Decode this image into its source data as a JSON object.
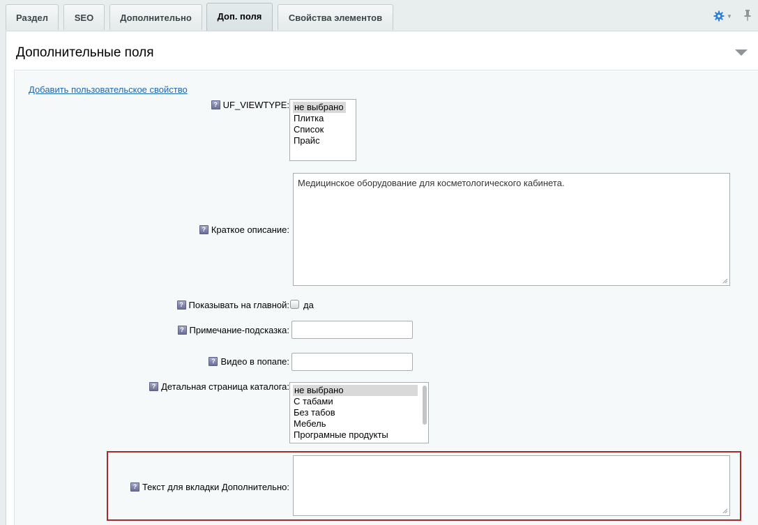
{
  "tabs": [
    {
      "label": "Раздел"
    },
    {
      "label": "SEO"
    },
    {
      "label": "Дополнительно"
    },
    {
      "label": "Доп. поля",
      "active": true
    },
    {
      "label": "Свойства элементов"
    }
  ],
  "panel": {
    "title": "Дополнительные поля",
    "add_link": "Добавить пользовательское свойство"
  },
  "fields": {
    "viewtype": {
      "label": "UF_VIEWTYPE:",
      "options": [
        "не выбрано",
        "Плитка",
        "Список",
        "Прайс"
      ],
      "selected": "не выбрано"
    },
    "short_desc": {
      "label": "Краткое описание:",
      "value": "Медицинское оборудование для косметологического кабинета."
    },
    "show_main": {
      "label": "Показывать на главной:",
      "checkbox_label": "да",
      "checked": false
    },
    "hint": {
      "label": "Примечание-подсказка:",
      "value": ""
    },
    "video": {
      "label": "Видео в попапе:",
      "value": ""
    },
    "catalog_page": {
      "label": "Детальная страница каталога:",
      "options": [
        "не выбрано",
        "С табами",
        "Без табов",
        "Мебель",
        "Програмные продукты"
      ],
      "selected": "не выбрано"
    },
    "tab_text": {
      "label": "Текст для вкладки Дополнительно:",
      "value": ""
    }
  },
  "help_glyph": "?",
  "colors": {
    "link": "#2067b0",
    "highlight_border": "#a32b2b",
    "gear": "#2f7fd6"
  }
}
